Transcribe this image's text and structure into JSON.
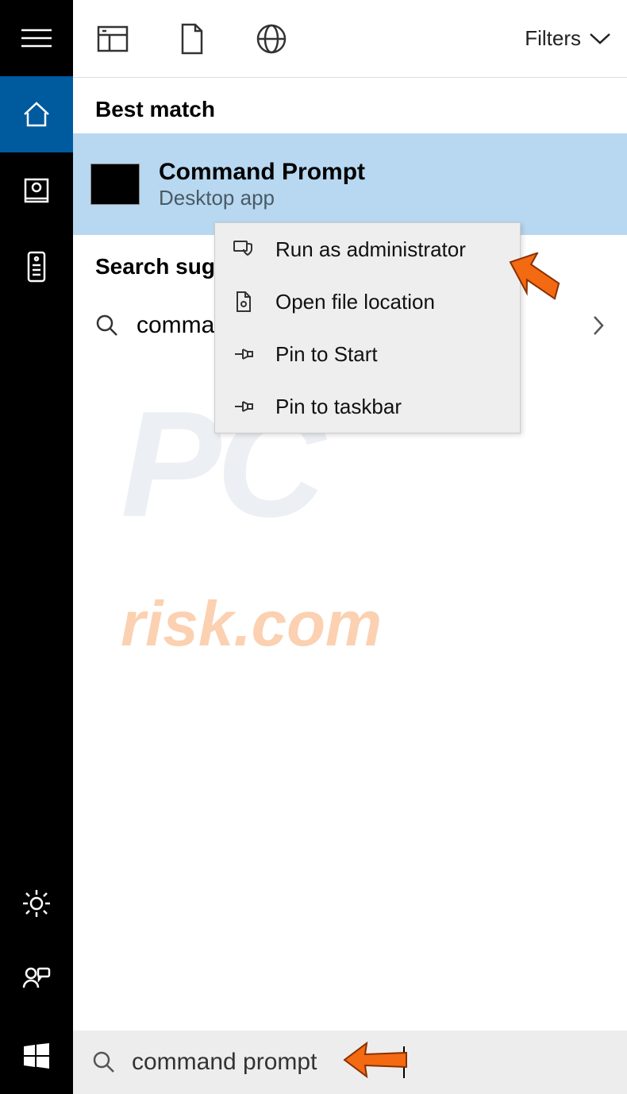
{
  "sidebar": {
    "items": [
      "menu",
      "home",
      "photos",
      "remote",
      "settings",
      "feedback",
      "start"
    ]
  },
  "topbar": {
    "icons": [
      "apps",
      "documents",
      "web"
    ],
    "filters_label": "Filters"
  },
  "sections": {
    "best_match_label": "Best match",
    "search_suggestions_label": "Search sugge"
  },
  "best_match": {
    "title": "Command Prompt",
    "subtitle": "Desktop app"
  },
  "suggestion": {
    "text": "comma"
  },
  "context_menu": {
    "items": [
      {
        "label": "Run as administrator"
      },
      {
        "label": "Open file location"
      },
      {
        "label": "Pin to Start"
      },
      {
        "label": "Pin to taskbar"
      }
    ]
  },
  "search": {
    "value": "command prompt"
  }
}
